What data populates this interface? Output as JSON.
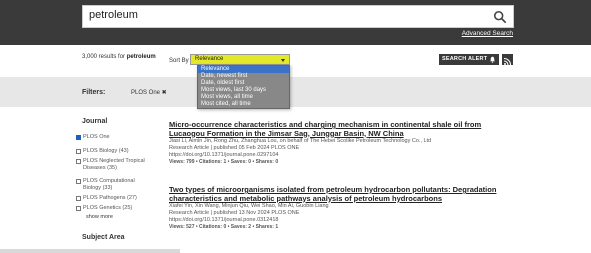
{
  "search": {
    "query": "petroleum",
    "advanced_label": "Advanced Search"
  },
  "results": {
    "count_prefix": "3,000 results for ",
    "count_query": "petroleum"
  },
  "sort": {
    "label": "Sort By",
    "selected": "Relevance",
    "options": [
      "Relevance",
      "Date, newest first",
      "Date, oldest first",
      "Most views, last 30 days",
      "Most views, all time",
      "Most cited, all time"
    ]
  },
  "alerts": {
    "search_alert_label": "SEARCH ALERT"
  },
  "filters": {
    "label": "Filters:",
    "active": "PLOS One ✖"
  },
  "sidebar": {
    "journal_heading": "Journal",
    "journals": [
      {
        "label": "PLOS One",
        "checked": true
      },
      {
        "label": "PLOS Biology (43)",
        "checked": false
      },
      {
        "label": "PLOS Neglected Tropical Diseases (35)",
        "checked": false
      },
      {
        "label": "PLOS Computational Biology (33)",
        "checked": false
      },
      {
        "label": "PLOS Pathogens (27)",
        "checked": false
      },
      {
        "label": "PLOS Genetics (25)",
        "checked": false
      }
    ],
    "show_more": "show more",
    "subject_heading": "Subject Area"
  },
  "articles": [
    {
      "title": "Micro-occurrence characteristics and charging mechanism in continental shale oil from Lucaogou Formation in the Jimsar Sag, Junggar Basin, NW China",
      "authors": "Jiasi Li, Aimin Jin, Rong Zhu, Zhanghua Lou, on behalf of The Hebei Scolike Petroleum Technology Co., Ltd",
      "published": "Research Article | published 05 Feb 2024 PLOS ONE",
      "doi": "https://doi.org/10.1371/journal.pone.0297104",
      "stats": "Views: 799 • Citations: 1 • Saves: 0 • Shares: 0"
    },
    {
      "title": "Two types of microorganisms isolated from petroleum hydrocarbon pollutants: Degradation characteristics and metabolic pathways analysis of petroleum hydrocarbons",
      "authors": "Xiafei Yin, Xin Wang, Minjun Qiu, Wei Shao, Min Ai, Guobin Liang",
      "published": "Research Article | published 13 Nov 2024 PLOS ONE",
      "doi": "https://doi.org/10.1371/journal.pone.0312418",
      "stats": "Views: 527 • Citations: 0 • Saves: 2 • Shares: 1"
    }
  ]
}
